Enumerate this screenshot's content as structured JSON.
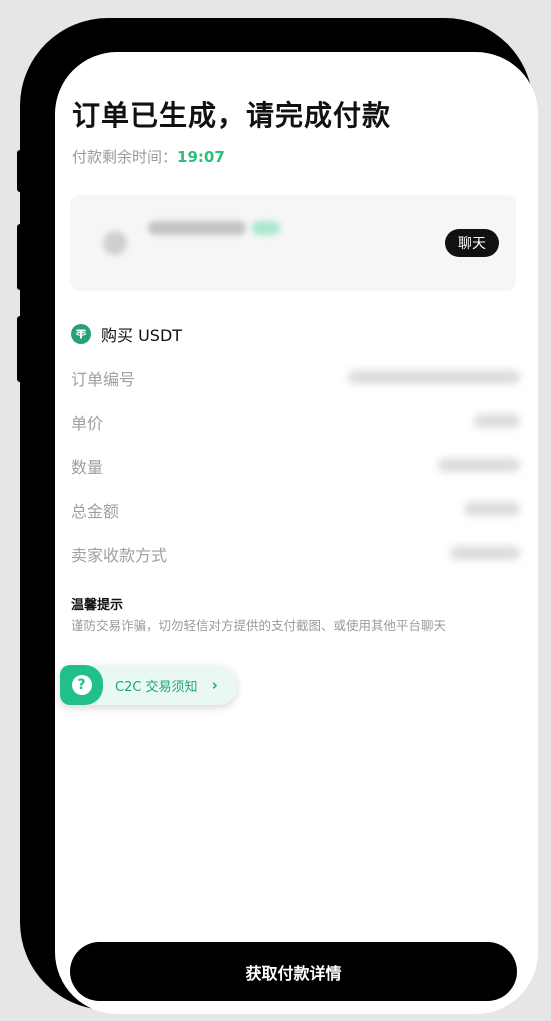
{
  "header": {
    "title": "订单已生成，请完成付款",
    "timer_label": "付款剩余时间：",
    "timer_value": "19:07"
  },
  "seller": {
    "chat_label": "聊天"
  },
  "order": {
    "buy_label": "购买 USDT",
    "fields": [
      {
        "label": "订单编号"
      },
      {
        "label": "单价"
      },
      {
        "label": "数量"
      },
      {
        "label": "总金额"
      },
      {
        "label": "卖家收款方式"
      }
    ]
  },
  "tips": {
    "title": "温馨提示",
    "text": "谨防交易诈骗，切勿轻信对方提供的支付截图、或使用其他平台聊天"
  },
  "notice": {
    "label": "C2C 交易须知",
    "icon": "question-icon"
  },
  "footer": {
    "button_label": "获取付款详情"
  },
  "colors": {
    "accent": "#2bbf7a",
    "tether": "#26a17b",
    "button": "#000000"
  }
}
